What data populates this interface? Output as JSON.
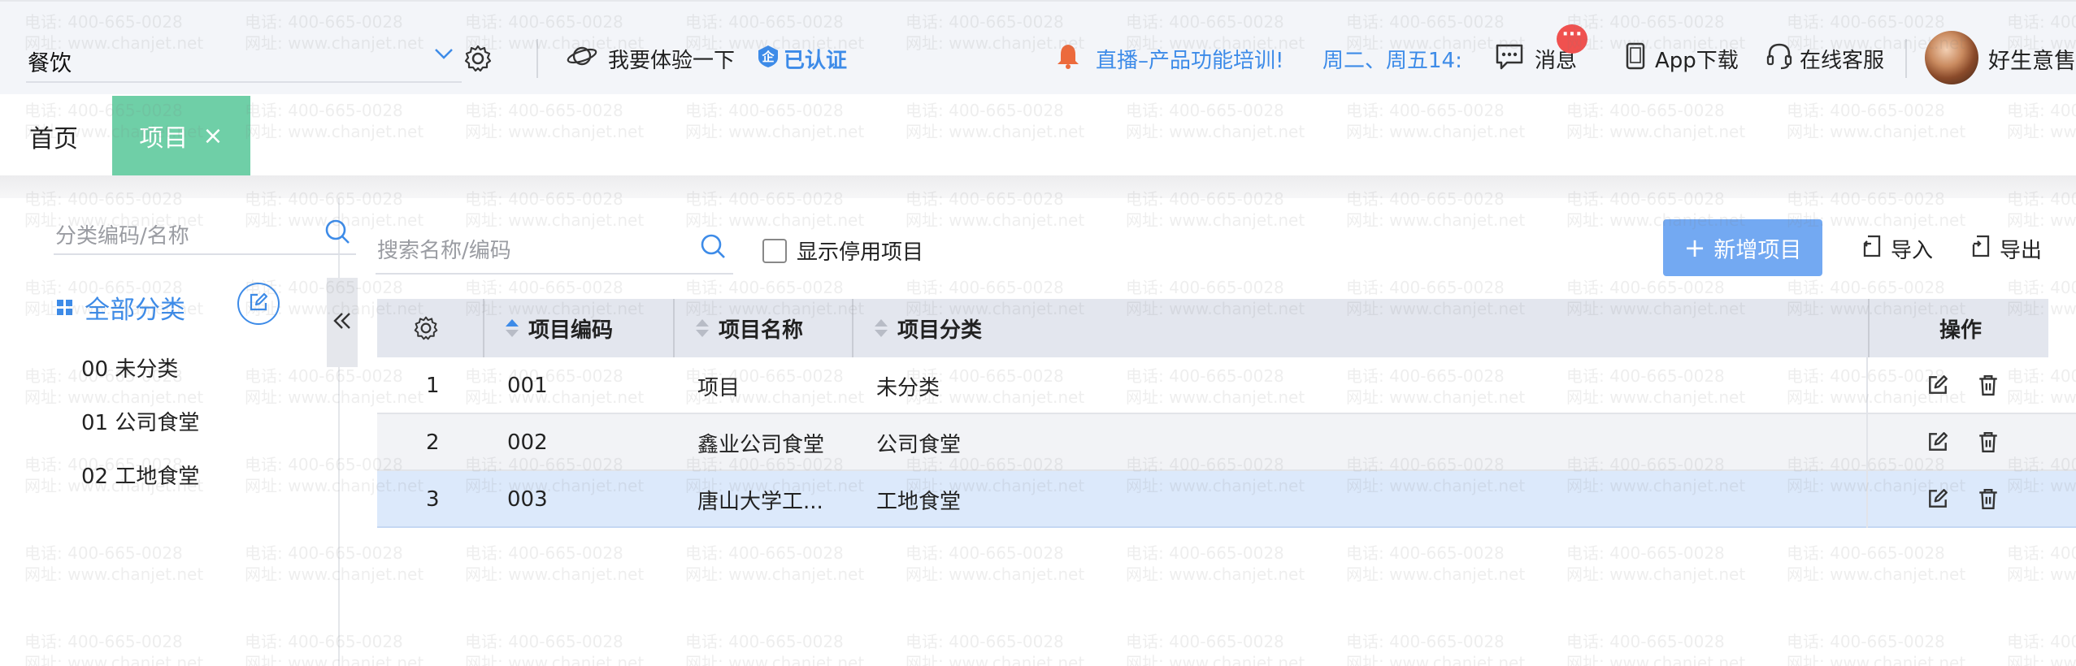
{
  "header": {
    "company": "餐饮",
    "experience": "我要体验一下",
    "certified": "已认证",
    "live_notice": "直播–产品功能培训!",
    "schedule": "周二、周五14:(",
    "messages": "消息",
    "message_badge": "···",
    "app_download": "App下载",
    "support": "在线客服",
    "user_name": "好生意售"
  },
  "tabs": {
    "home": "首页",
    "active": "项目",
    "close": "×"
  },
  "sidebar": {
    "search_placeholder": "分类编码/名称",
    "root": "全部分类",
    "items": [
      {
        "label": "00 未分类"
      },
      {
        "label": "01 公司食堂"
      },
      {
        "label": "02 工地食堂"
      }
    ]
  },
  "toolbar": {
    "search_placeholder": "搜索名称/编码",
    "show_disabled": "显示停用项目",
    "add_label": "新增项目",
    "add_plus": "+",
    "import_label": "导入",
    "export_label": "导出"
  },
  "table": {
    "columns": {
      "code": "项目编码",
      "name": "项目名称",
      "category": "项目分类",
      "actions": "操作"
    },
    "rows": [
      {
        "index": "1",
        "code": "001",
        "name": "项目",
        "category": "未分类"
      },
      {
        "index": "2",
        "code": "002",
        "name": "鑫业公司食堂",
        "category": "公司食堂"
      },
      {
        "index": "3",
        "code": "003",
        "name": "唐山大学工...",
        "category": "工地食堂"
      }
    ]
  },
  "watermark": {
    "phone": "电话: 400-665-0028",
    "site": "网址: www.chanjet.net"
  },
  "colors": {
    "accent": "#3d8be8",
    "active_tab": "#6fcfa7",
    "add_button": "#73a9f2",
    "selected_row": "#dce9fb",
    "badge": "#f0514f"
  }
}
